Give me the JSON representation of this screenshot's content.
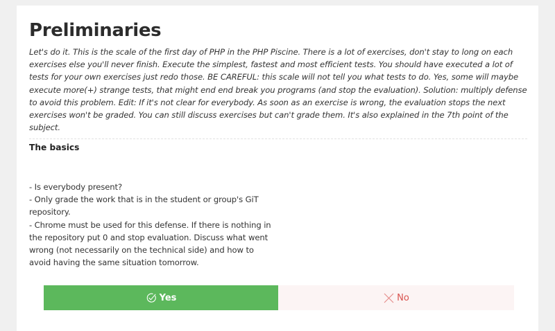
{
  "scale": {
    "title": "Preliminaries",
    "description": "Let's do it. This is the scale of the first day of PHP in the PHP Piscine. There is a lot of exercises, don't stay to long on each exercises else you'll never finish. Execute the simplest, fastest and most efficient tests. You should have executed a lot of tests for your own exercises just redo those. BE CAREFUL: this scale will not tell you what tests to do. Yes, some will maybe execute more(+) strange tests, that might end end break you programs (and stop the evaluation). Solution: multiply defense to avoid this problem. Edit: If it's not clear for everybody. As soon as an exercise is wrong, the evaluation stops the next exercises won't be graded. You can still discuss exercises but can't grade them. It's also explained in the 7th point of the subject."
  },
  "section": {
    "title": "The basics",
    "guidelines": [
      "- Is everybody present?",
      "- Only grade the work that is in the student or group's GiT repository.",
      "- Chrome must be used for this defense. If there is nothing in the repository put 0 and stop evaluation. Discuss what went wrong (not necessarily on the technical side) and how to avoid having the same situation tomorrow."
    ]
  },
  "answers": {
    "yes": {
      "label": "Yes",
      "icon": "check-circle-icon",
      "color": "#5cb85c"
    },
    "no": {
      "label": "No",
      "icon": "close-icon",
      "color": "#d9534f"
    }
  },
  "colors": {
    "background": "#f0f0f0",
    "card": "#ffffff",
    "text": "#333333",
    "yes_bg": "#5cb85c",
    "no_bg": "#fcf4f4"
  }
}
